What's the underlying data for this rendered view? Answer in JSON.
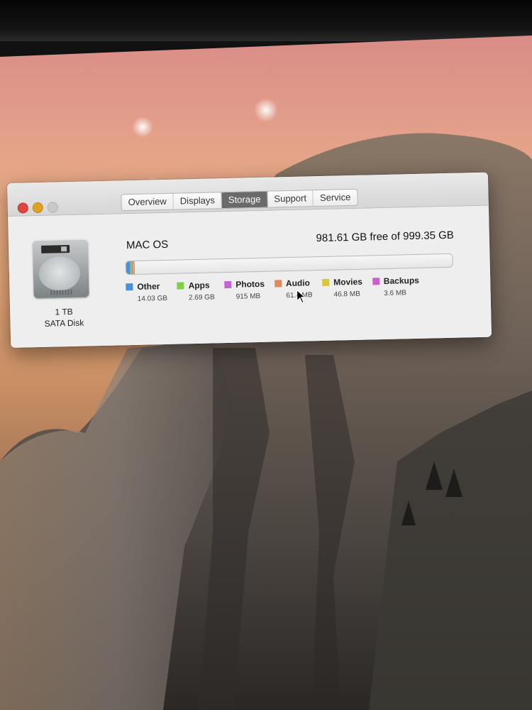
{
  "window": {
    "tabs": [
      {
        "label": "Overview",
        "active": false
      },
      {
        "label": "Displays",
        "active": false
      },
      {
        "label": "Storage",
        "active": true
      },
      {
        "label": "Support",
        "active": false
      },
      {
        "label": "Service",
        "active": false
      }
    ]
  },
  "storage": {
    "disk_icon": "hard-disk-icon",
    "disk_capacity": "1 TB",
    "disk_type": "SATA Disk",
    "volume_name": "MAC OS",
    "free_summary": "981.61 GB free of 999.35 GB",
    "used_fraction_of_capacity": 0.0178,
    "categories": [
      {
        "name": "Other",
        "size": "14.03 GB",
        "color": "#4a90d9"
      },
      {
        "name": "Apps",
        "size": "2.69 GB",
        "color": "#7fcf4a"
      },
      {
        "name": "Photos",
        "size": "915 MB",
        "color": "#c463d8"
      },
      {
        "name": "Audio",
        "size": "61.4 MB",
        "color": "#e08a5c"
      },
      {
        "name": "Movies",
        "size": "46.8 MB",
        "color": "#dbc63b"
      },
      {
        "name": "Backups",
        "size": "3.6 MB",
        "color": "#cc5fc7"
      }
    ]
  }
}
